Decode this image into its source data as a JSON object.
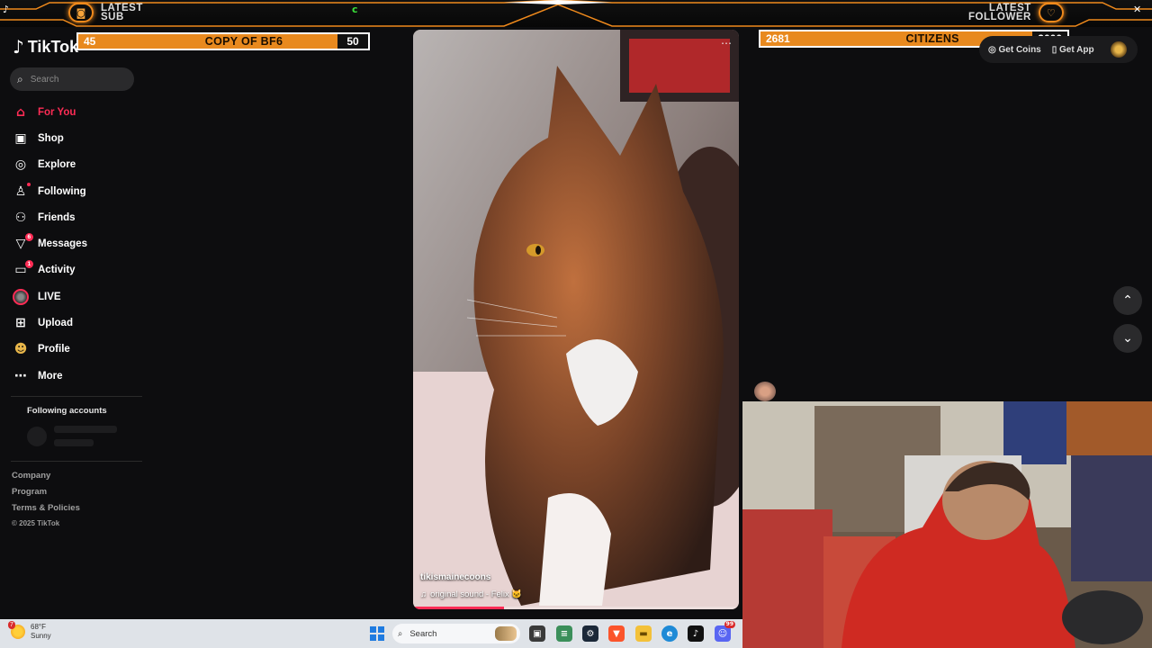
{
  "overlay": {
    "latest_sub_label_1": "LATEST",
    "latest_sub_label_2": "SUB",
    "latest_follower_label_1": "LATEST",
    "latest_follower_label_2": "FOLLOWER",
    "close_glyph": "✕",
    "accent": "#f08a1c"
  },
  "goals": [
    {
      "current": "45",
      "title": "COPY OF BF6",
      "max": "50",
      "progress": 0.9
    },
    {
      "current": "2681",
      "title": "CITIZENS",
      "max": "3000",
      "progress": 0.894
    }
  ],
  "app": {
    "logo_text": "TikTok",
    "brand_color": "#fe2c55"
  },
  "search": {
    "placeholder": "Search"
  },
  "nav": [
    {
      "label": "For You",
      "icon": "home-icon",
      "active": true
    },
    {
      "label": "Shop",
      "icon": "shop-icon"
    },
    {
      "label": "Explore",
      "icon": "compass-icon"
    },
    {
      "label": "Following",
      "icon": "following-icon",
      "dot": true
    },
    {
      "label": "Friends",
      "icon": "friends-icon"
    },
    {
      "label": "Messages",
      "icon": "messages-icon",
      "badge": "6"
    },
    {
      "label": "Activity",
      "icon": "activity-icon",
      "badge": "1"
    },
    {
      "label": "LIVE",
      "icon": "live-icon"
    },
    {
      "label": "Upload",
      "icon": "upload-icon"
    },
    {
      "label": "Profile",
      "icon": "profile-icon"
    },
    {
      "label": "More",
      "icon": "more-icon"
    }
  ],
  "following_accounts": {
    "title": "Following accounts"
  },
  "footer": {
    "links": [
      "Company",
      "Program",
      "Terms & Policies"
    ],
    "copyright": "© 2025 TikTok"
  },
  "video": {
    "username": "tikismainecoons",
    "sound": "original sound - Felix 🐱"
  },
  "header_right": {
    "coins": "Get Coins",
    "app": "Get App"
  },
  "taskbar": {
    "weather_badge": "7",
    "temp": "68°F",
    "condition": "Sunny",
    "search_placeholder": "Search",
    "discord_badge": "99"
  }
}
